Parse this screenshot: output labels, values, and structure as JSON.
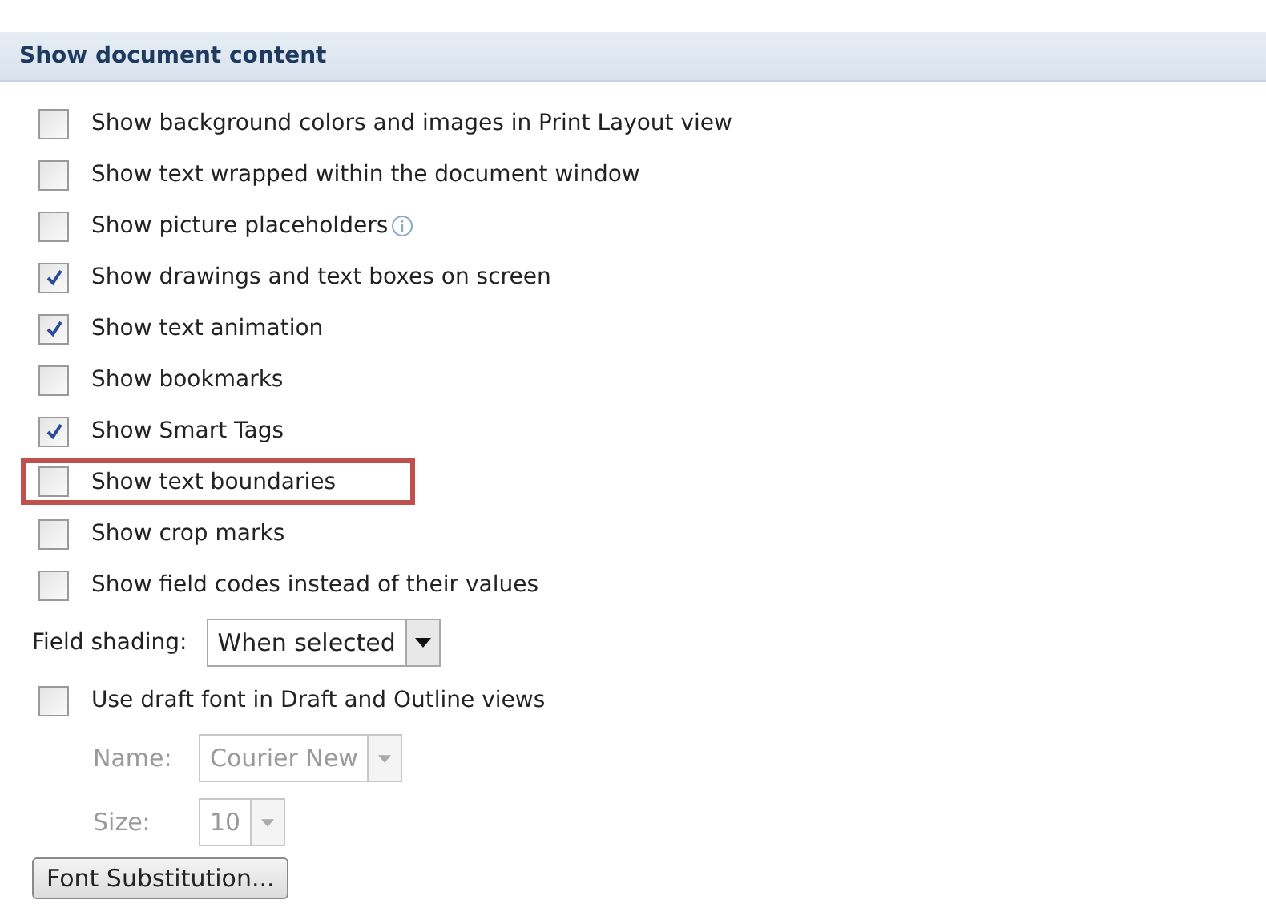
{
  "section": {
    "title": "Show document content"
  },
  "options": [
    {
      "label": "Show background colors and images in Print Layout view",
      "checked": false,
      "info": false,
      "highlighted": false
    },
    {
      "label": "Show text wrapped within the document window",
      "checked": false,
      "info": false,
      "highlighted": false
    },
    {
      "label": "Show picture placeholders",
      "checked": false,
      "info": true,
      "highlighted": false
    },
    {
      "label": "Show drawings and text boxes on screen",
      "checked": true,
      "info": false,
      "highlighted": false
    },
    {
      "label": "Show text animation",
      "checked": true,
      "info": false,
      "highlighted": false
    },
    {
      "label": "Show bookmarks",
      "checked": false,
      "info": false,
      "highlighted": false
    },
    {
      "label": "Show Smart Tags",
      "checked": true,
      "info": false,
      "highlighted": false
    },
    {
      "label": "Show text boundaries",
      "checked": false,
      "info": false,
      "highlighted": true
    },
    {
      "label": "Show crop marks",
      "checked": false,
      "info": false,
      "highlighted": false
    },
    {
      "label": "Show field codes instead of their values",
      "checked": false,
      "info": false,
      "highlighted": false
    }
  ],
  "field_shading": {
    "label": "Field shading:",
    "value": "When selected",
    "disabled": false
  },
  "draft_font": {
    "label": "Use draft font in Draft and Outline views",
    "checked": false
  },
  "draft_fields": [
    {
      "label": "Name:",
      "value": "Courier New",
      "disabled": true
    },
    {
      "label": "Size:",
      "value": "10",
      "disabled": true
    }
  ],
  "button": {
    "label": "Font Substitution..."
  }
}
